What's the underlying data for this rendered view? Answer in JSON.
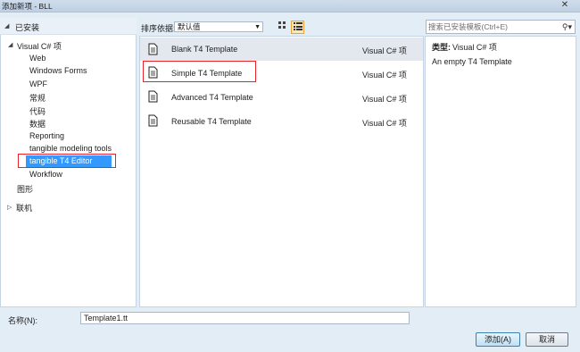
{
  "window": {
    "title": "添加新项 - BLL",
    "close_glyph": "✕"
  },
  "left": {
    "installed_label": "已安装",
    "tree": [
      {
        "label": "Visual C# 项"
      },
      {
        "label": "Web"
      },
      {
        "label": "Windows Forms"
      },
      {
        "label": "WPF"
      },
      {
        "label": "常规"
      },
      {
        "label": "代码"
      },
      {
        "label": "数据"
      },
      {
        "label": "Reporting"
      },
      {
        "label": "tangible modeling tools"
      },
      {
        "label": "tangible T4 Editor"
      },
      {
        "label": "Workflow"
      },
      {
        "label": "图形"
      }
    ],
    "online_label": "联机"
  },
  "toolbar": {
    "sort_label": "排序依据:",
    "sort_value": "默认值"
  },
  "templates": [
    {
      "name": "Blank T4 Template",
      "lang": "Visual C# 项"
    },
    {
      "name": "Simple T4 Template",
      "lang": "Visual C# 项"
    },
    {
      "name": "Advanced T4 Template",
      "lang": "Visual C# 项"
    },
    {
      "name": "Reusable T4 Template",
      "lang": "Visual C# 项"
    }
  ],
  "right": {
    "search_placeholder": "搜索已安装模板(Ctrl+E)",
    "type_label": "类型:",
    "type_value": "Visual C# 项",
    "description": "An empty T4 Template"
  },
  "bottom": {
    "name_label": "名称(N):",
    "name_value": "Template1.tt",
    "add_label": "添加(A)",
    "cancel_label": "取消"
  },
  "colors": {
    "selection": "#3399ff",
    "highlight_box": "#e8242a"
  }
}
